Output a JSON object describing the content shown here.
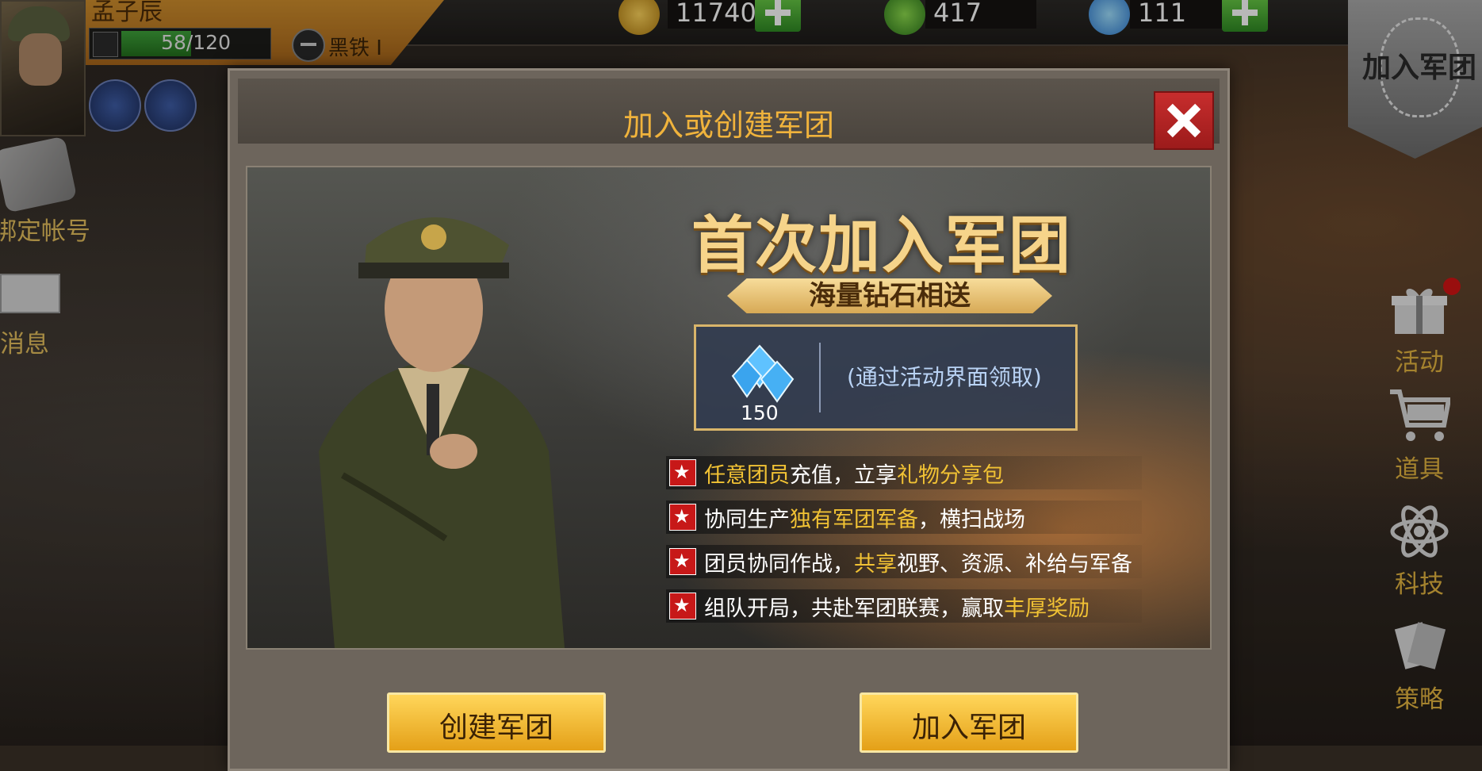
{
  "player": {
    "name": "孟子辰",
    "hp_text": "58/120",
    "hp_fraction": 0.48,
    "rank": "黑铁 I"
  },
  "resources": {
    "gold": "117400",
    "oil": "417",
    "diamond": "111"
  },
  "left_menu": {
    "account_label": "绑定帐号",
    "message_label": "消息"
  },
  "right_menu": {
    "join_legion": "加入军团",
    "activity": "活动",
    "items": "道具",
    "tech": "科技",
    "strategy": "策略"
  },
  "modal": {
    "title": "加入或创建军团",
    "headline": "首次加入军团",
    "subheadline": "海量钻石相送",
    "reward_amount": "150",
    "reward_note": "(通过活动界面领取)",
    "features": [
      {
        "pre": "",
        "hl1": "任意团员",
        "mid": "充值，立享",
        "hl2": "礼物分享包",
        "post": ""
      },
      {
        "pre": "协同生产",
        "hl1": "独有军团军备",
        "mid": "，横扫战场",
        "hl2": "",
        "post": ""
      },
      {
        "pre": "团员协同作战，",
        "hl1": "共享",
        "mid": "视野、资源、补给与军备",
        "hl2": "",
        "post": ""
      },
      {
        "pre": "组队开局，共赴军团联赛，赢取",
        "hl1": "丰厚奖励",
        "mid": "",
        "hl2": "",
        "post": ""
      }
    ],
    "create_button": "创建军团",
    "join_button": "加入军团"
  },
  "colors": {
    "accent_gold": "#f0b33c",
    "highlight": "#f1c234",
    "close_red": "#c72d2d"
  }
}
